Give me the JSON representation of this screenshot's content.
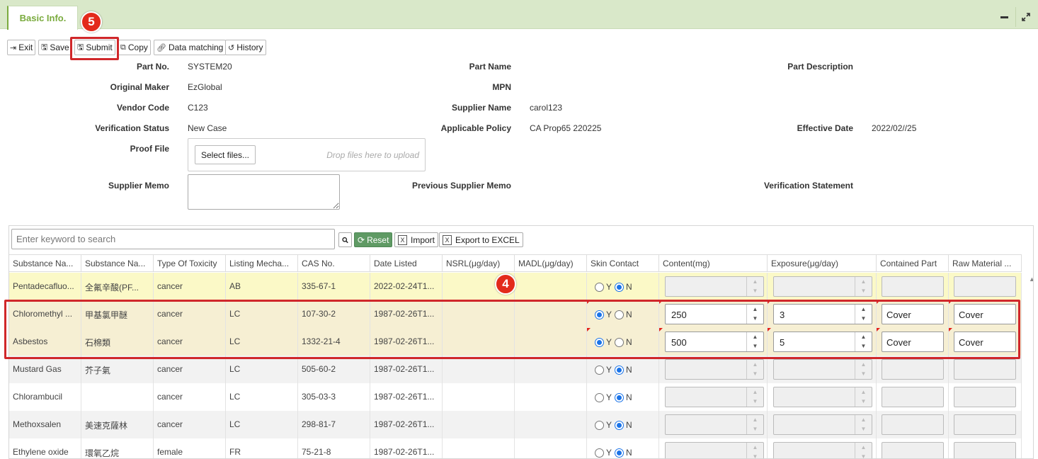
{
  "tab": {
    "label": "Basic Info."
  },
  "toolbar": {
    "exit": "Exit",
    "save": "Save",
    "submit": "Submit",
    "copy": "Copy",
    "data_matching": "Data matching",
    "history": "History"
  },
  "badges": {
    "submit_step": "5",
    "rows_step": "4"
  },
  "form": {
    "part_no_label": "Part No.",
    "part_no": "SYSTEM20",
    "part_name_label": "Part Name",
    "part_description_label": "Part Description",
    "original_maker_label": "Original Maker",
    "original_maker": "EzGlobal",
    "mpn_label": "MPN",
    "vendor_code_label": "Vendor Code",
    "vendor_code": "C123",
    "supplier_name_label": "Supplier Name",
    "supplier_name": "carol123",
    "verification_status_label": "Verification Status",
    "verification_status": "New Case",
    "applicable_policy_label": "Applicable Policy",
    "applicable_policy": "CA Prop65 220225",
    "effective_date_label": "Effective Date",
    "effective_date": "2022/02//25",
    "proof_file_label": "Proof File",
    "select_files": "Select files...",
    "drop_hint": "Drop files here to upload",
    "supplier_memo_label": "Supplier Memo",
    "previous_supplier_memo_label": "Previous Supplier Memo",
    "verification_statement_label": "Verification Statement"
  },
  "grid": {
    "search_placeholder": "Enter keyword to search",
    "reset": "Reset",
    "import": "Import",
    "export": "Export to EXCEL",
    "columns": [
      "Substance Na...",
      "Substance Na...",
      "Type Of Toxicity",
      "Listing Mecha...",
      "CAS No.",
      "Date Listed",
      "NSRL(μg/day)",
      "MADL(μg/day)",
      "Skin Contact",
      "Content(mg)",
      "Exposure(μg/day)",
      "Contained Part",
      "Raw Material ..."
    ],
    "radio_y": "Y",
    "radio_n": "N",
    "rows": [
      {
        "name_en": "Pentadecafluo...",
        "name_zh": "全氟辛酸(PF...",
        "toxicity": "cancer",
        "mechanism": "AB",
        "cas": "335-67-1",
        "date": "2022-02-24T1...",
        "nsrl": "",
        "madl": "",
        "skin": "N",
        "content": "",
        "exposure": "",
        "part": "",
        "raw": ""
      },
      {
        "name_en": "Chloromethyl ...",
        "name_zh": "甲基氯甲醚",
        "toxicity": "cancer",
        "mechanism": "LC",
        "cas": "107-30-2",
        "date": "1987-02-26T1...",
        "nsrl": "",
        "madl": "",
        "skin": "Y",
        "content": "250",
        "exposure": "3",
        "part": "Cover",
        "raw": "Cover"
      },
      {
        "name_en": "Asbestos",
        "name_zh": "石棉類",
        "toxicity": "cancer",
        "mechanism": "LC",
        "cas": "1332-21-4",
        "date": "1987-02-26T1...",
        "nsrl": "",
        "madl": "",
        "skin": "Y",
        "content": "500",
        "exposure": "5",
        "part": "Cover",
        "raw": "Cover"
      },
      {
        "name_en": "Mustard Gas",
        "name_zh": "芥子氣",
        "toxicity": "cancer",
        "mechanism": "LC",
        "cas": "505-60-2",
        "date": "1987-02-26T1...",
        "nsrl": "",
        "madl": "",
        "skin": "N",
        "content": "",
        "exposure": "",
        "part": "",
        "raw": ""
      },
      {
        "name_en": "Chlorambucil",
        "name_zh": "",
        "toxicity": "cancer",
        "mechanism": "LC",
        "cas": "305-03-3",
        "date": "1987-02-26T1...",
        "nsrl": "",
        "madl": "",
        "skin": "N",
        "content": "",
        "exposure": "",
        "part": "",
        "raw": ""
      },
      {
        "name_en": "Methoxsalen",
        "name_zh": "美速克薩林",
        "toxicity": "cancer",
        "mechanism": "LC",
        "cas": "298-81-7",
        "date": "1987-02-26T1...",
        "nsrl": "",
        "madl": "",
        "skin": "N",
        "content": "",
        "exposure": "",
        "part": "",
        "raw": ""
      },
      {
        "name_en": "Ethylene oxide",
        "name_zh": "環氧乙烷",
        "toxicity": "female",
        "mechanism": "FR",
        "cas": "75-21-8",
        "date": "1987-02-26T1...",
        "nsrl": "",
        "madl": "",
        "skin": "N",
        "content": "",
        "exposure": "",
        "part": "",
        "raw": ""
      }
    ]
  }
}
